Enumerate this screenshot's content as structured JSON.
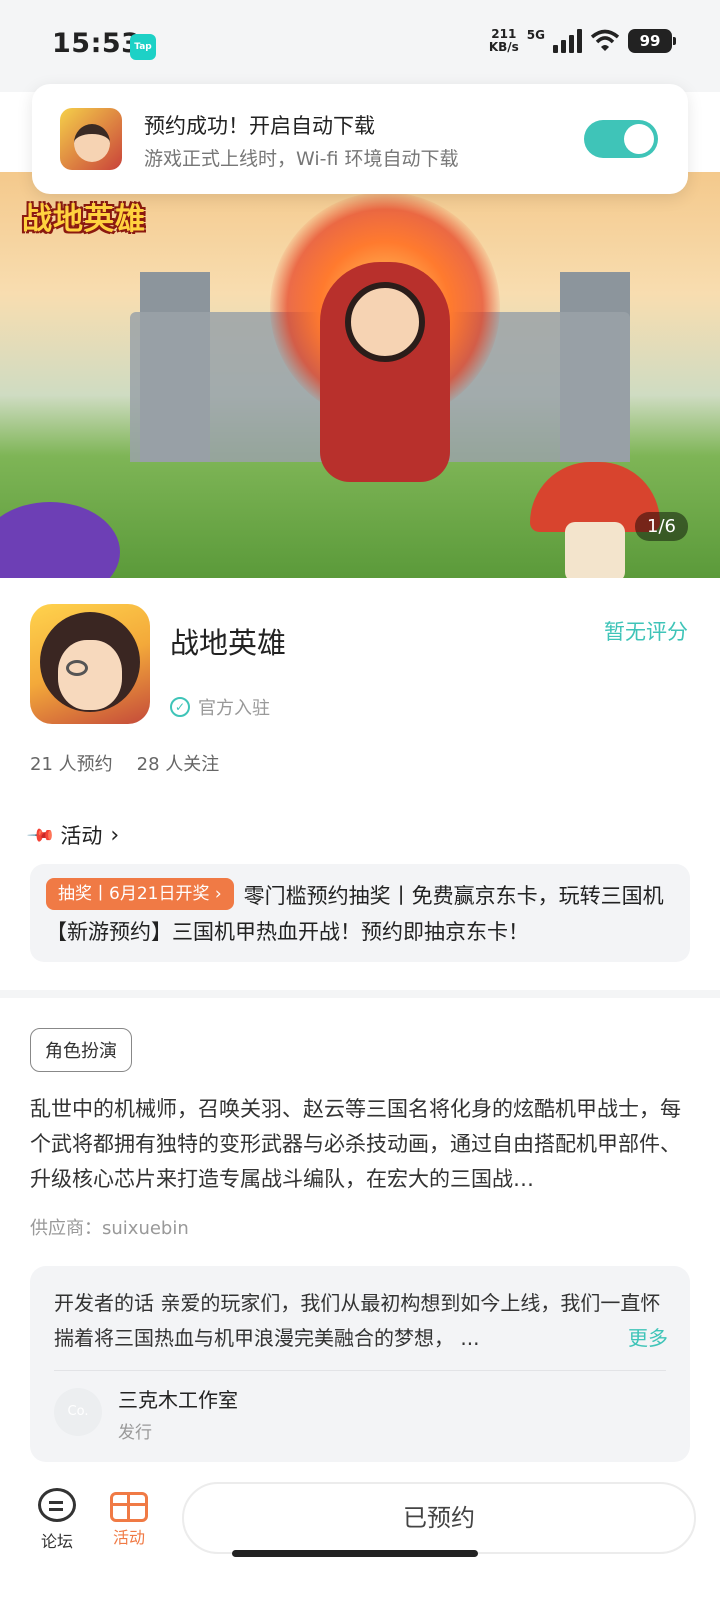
{
  "status_bar": {
    "time": "15:53",
    "tap_badge": "Tap",
    "net_speed_value": "211",
    "net_speed_unit": "KB/s",
    "network": "5G",
    "battery": "99"
  },
  "notification": {
    "title": "预约成功！开启自动下载",
    "subtitle": "游戏正式上线时，Wi-fi 环境自动下载",
    "toggle_on": true
  },
  "banner": {
    "logo_text": "战地英雄",
    "page_indicator": "1/6"
  },
  "app": {
    "name": "战地英雄",
    "rating_text": "暂无评分",
    "verified_label": "官方入驻",
    "reservations": "21 人预约",
    "followers": "28 人关注"
  },
  "activity": {
    "header": "活动",
    "tag": "抽奖丨6月21日开奖 ›",
    "text": "零门槛预约抽奖丨免费赢京东卡，玩转三国机 【新游预约】三国机甲热血开战！预约即抽京东卡！"
  },
  "description": {
    "genre": "角色扮演",
    "text": "乱世中的机械师，召唤关羽、赵云等三国名将化身的炫酷机甲战士，每个武将都拥有独特的变形武器与必杀技动画，通过自由搭配机甲部件、升级核心芯片来打造专属战斗编队，在宏大的三国战…",
    "supplier": "供应商：suixuebin"
  },
  "developer": {
    "text": "开发者的话  亲爱的玩家们，我们从最初构想到如今上线，我们一直怀揣着将三国热血与机甲浪漫完美融合的梦想， ...",
    "more": "更多",
    "avatar_text": "Co.",
    "studio_name": "三克木工作室",
    "studio_role": "发行"
  },
  "bottom_nav": {
    "forum": "论坛",
    "activity": "活动",
    "reserved_button": "已预约"
  },
  "colors": {
    "accent": "#3fc4b8",
    "activity_orange": "#f07a45"
  }
}
